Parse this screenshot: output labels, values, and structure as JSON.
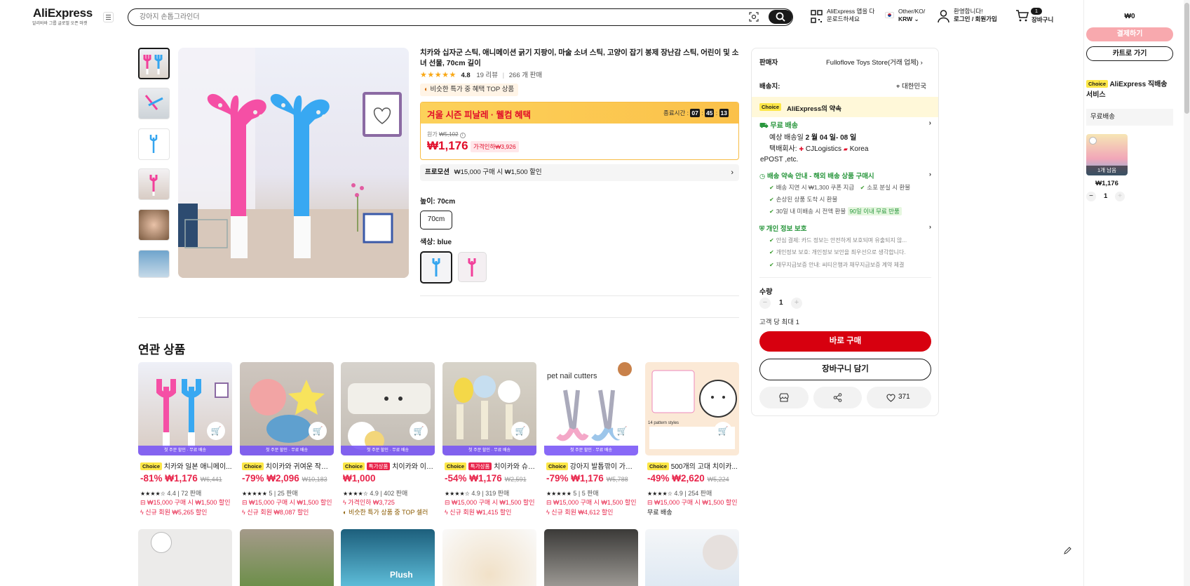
{
  "header": {
    "logo": "AliExpress",
    "logo_sub": "알리바바 그룹 글로벌 오픈 마켓",
    "search_placeholder": "강아지 손톱그라인더",
    "app_promo_l1": "AliExpress 앱을 다",
    "app_promo_l2": "운로드하세요",
    "locale_l1": "Other/KO/",
    "locale_l2": "KRW",
    "account_l1": "환영합니다!",
    "account_l2": "로그인 / 회원가입",
    "cart_count": "1",
    "cart_label": "장바구니"
  },
  "product": {
    "title": "치카와 십자군 스틱, 애니메이션 긁기 지팡이, 마술 소녀 스틱, 고양이 잡기 봉제 장난감 스틱, 어린이 및 소녀 선물, 70cm 길이",
    "stars": "★★★★★",
    "rating": "4.8",
    "reviews": "19 리뷰",
    "sold": "266 개 판매",
    "badge": "비슷한 특가 중 혜택 TOP 상품",
    "sale_title": "겨울 시즌 피날레 · 웰컴 혜택",
    "timer_label": "종료시간 :",
    "timer_h": "07",
    "timer_m": "45",
    "timer_s": "13",
    "orig_label": "원가",
    "orig_price": "₩5,102",
    "price": "₩1,176",
    "discount": "가격인하₩3,926",
    "promo_label": "프로모션",
    "promo_text": "₩15,000 구매 시 ₩1,500 할인",
    "height_label": "높이: 70cm",
    "height_option": "70cm",
    "color_label": "색상: blue"
  },
  "seller": {
    "seller_label": "판매자",
    "seller_name": "Fulloflove Toys Store(거래 업체)",
    "ship_label": "배송지:",
    "ship_to": "대한민국",
    "choice_tag": "Choice",
    "promise": "AliExpress의 약속",
    "free_ship": "무료 배송",
    "delivery_prefix": "예상 배송일",
    "delivery_date": "2 월 04 일- 08 일",
    "carrier_prefix": "택배회사:",
    "carrier_1": "CJLogistics",
    "carrier_2": "Korea",
    "carrier_3": "ePOST ,etc.",
    "promise_link": "배송 약속 안내 - 해외 배송 상품 구매시",
    "g1": "배송 지연 시 ₩1,300 쿠폰 지급",
    "g2": "소포 분실 시 환불",
    "g3": "손상된 상품 도착 시 환불",
    "g4": "30일 내 미배송 시 전액 환불",
    "g4_tag": "90일 이내 무료 반품",
    "privacy": "개인 정보 보호",
    "p1": "안심 결제: 카드 정보는 안전하게 보호되며 유출되지 않...",
    "p2": "개인정보 보호: 개인정보 보안을 최우선으로 생각합니다.",
    "p3": "채무지급보증 안내: 씨티은행과 채무지급보증 계약 체결",
    "qty_label": "수량",
    "qty": "1",
    "max_label": "고객 당 최대 1",
    "buy_now": "바로 구매",
    "add_cart": "장바구니 담기",
    "wish_count": "371"
  },
  "right_panel": {
    "total": "₩0",
    "pay": "결제하기",
    "go_cart": "카트로 가기",
    "choice_tag": "Choice",
    "service_l1": "AliExpress 직배송",
    "service_l2": "서비스",
    "free_ship": "무료배송",
    "item_overlay": "1개 남음",
    "item_price": "₩1,176",
    "item_qty": "1"
  },
  "related": {
    "title": "연관 상품",
    "strip": "첫 주문 할인 · 무료 배송",
    "items": [
      {
        "title": "치카와 일본 애니메이...",
        "pct": "-81%",
        "price": "₩1,176",
        "orig": "₩6,441",
        "rating": "4.4",
        "sold": "72 판매",
        "promo": "₩15,000 구매 시 ₩1,500 할인",
        "extra": "신규 회원 ₩5,265 할인",
        "hot": ""
      },
      {
        "title": "치이카와 귀여운 작은 ...",
        "pct": "-79%",
        "price": "₩2,096",
        "orig": "₩10,183",
        "rating": "5",
        "sold": "25 판매",
        "promo": "₩15,000 구매 시 ₩1,500 할인",
        "extra": "신규 회원 ₩8,087 할인",
        "hot": ""
      },
      {
        "title": "치이카와 이모...",
        "pct": "",
        "price": "₩1,000",
        "orig": "",
        "rating": "4.9",
        "sold": "402 판매",
        "promo": "가격인하 ₩3,725",
        "extra": "비슷한 특가 상품 중 TOP 셀러",
        "hot": "특가상품"
      },
      {
        "title": "치이카와 슈퍼...",
        "pct": "-54%",
        "price": "₩1,176",
        "orig": "₩2,591",
        "rating": "4.9",
        "sold": "319 판매",
        "promo": "₩15,000 구매 시 ₩1,500 할인",
        "extra": "신규 회원 ₩1,415 할인",
        "hot": "특가상품"
      },
      {
        "title": "강아지 발톱깎이 가위 ...",
        "pct": "-79%",
        "price": "₩1,176",
        "orig": "₩5,788",
        "rating": "5",
        "sold": "5 판매",
        "promo": "₩15,000 구매 시 ₩1,500 할인",
        "extra": "신규 회원 ₩4,612 할인",
        "hot": ""
      },
      {
        "title": "500개의 고대 치이카...",
        "pct": "-49%",
        "price": "₩2,620",
        "orig": "₩5,224",
        "rating": "4.9",
        "sold": "254 판매",
        "promo": "₩15,000 구매 시 ₩1,500 할인",
        "extra": "무료 배송",
        "hot": ""
      }
    ],
    "img_text_5": "pet nail cutters",
    "img_text_6": "14 pattern styles",
    "img_text_r2": "Plush"
  }
}
